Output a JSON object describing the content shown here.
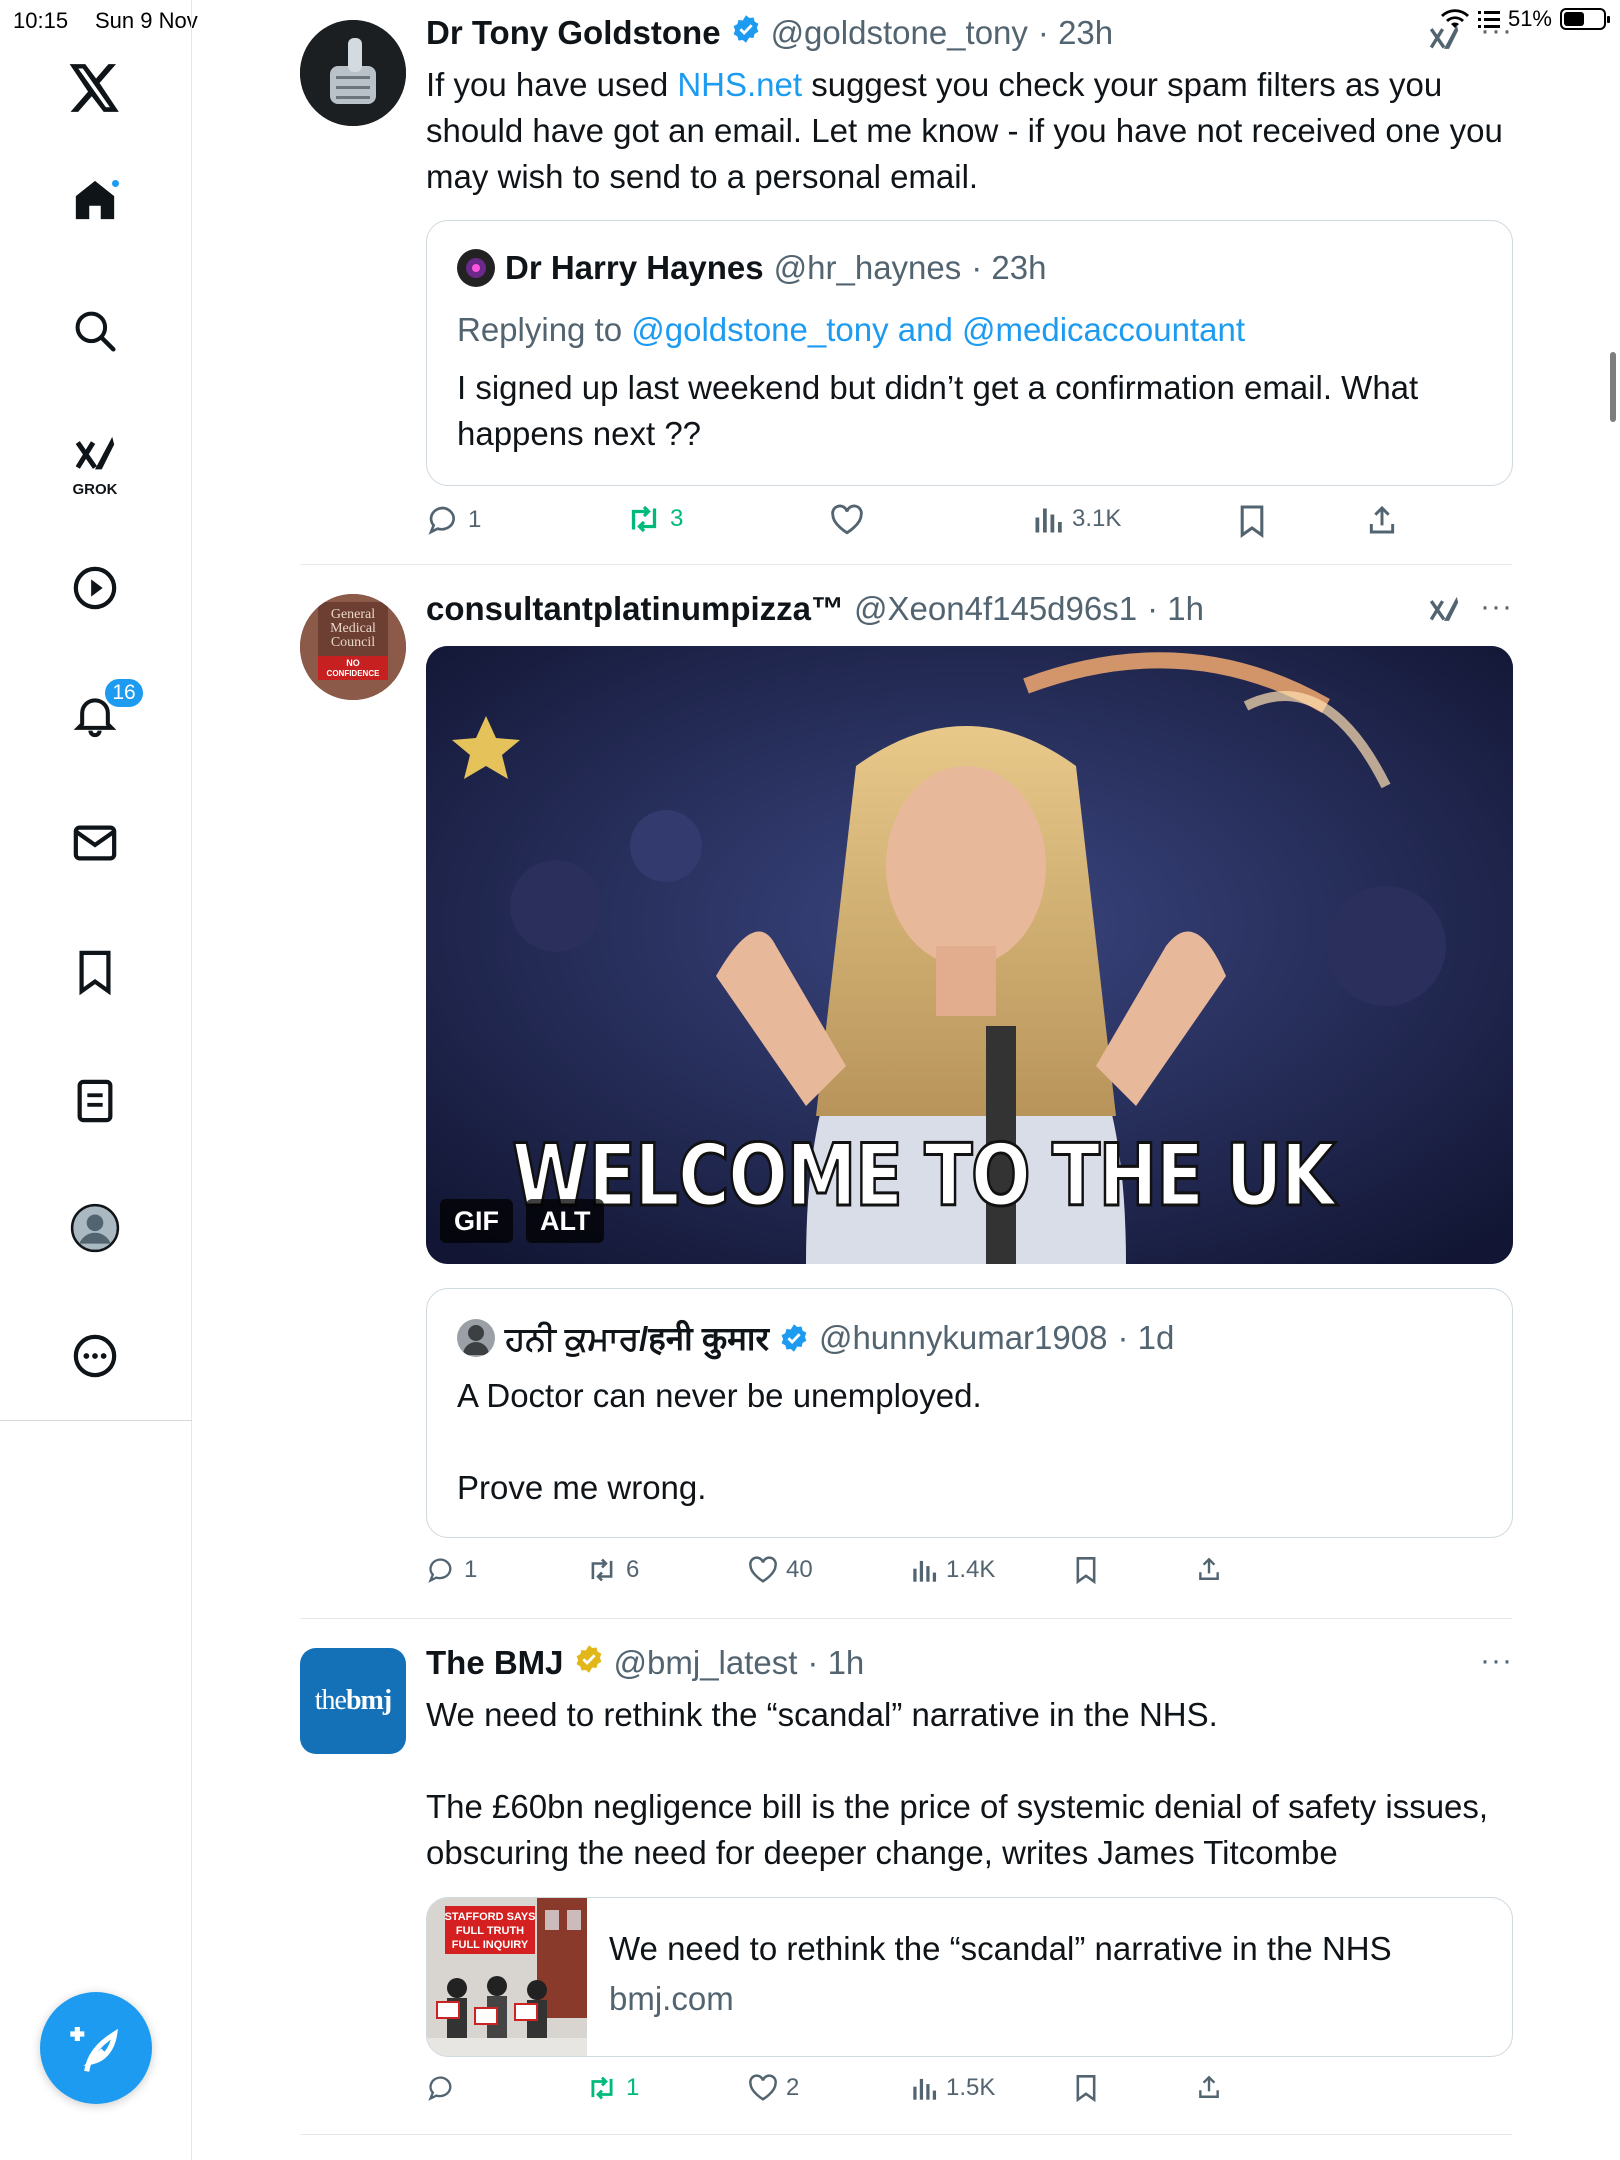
{
  "status_bar": {
    "time": "10:15",
    "date": "Sun 9 Nov",
    "battery": "51%"
  },
  "nav": {
    "notifications_badge": "16",
    "grok_label": "GROK"
  },
  "posts": [
    {
      "name": "Dr Tony Goldstone",
      "handle": "@goldstone_tony",
      "time": "· 23h",
      "text_before": "If you have used ",
      "link": "NHS.net",
      "text_after": " suggest you check your spam filters as you should have got an email. Let me know - if you have not received one you may wish to send to a personal email.",
      "quote": {
        "name": "Dr Harry Haynes",
        "handle": "@hr_haynes",
        "time": "· 23h",
        "replying_prefix": "Replying to ",
        "replying_to": "@goldstone_tony and @medicaccountant",
        "text": "I signed up last weekend but didn’t get a confirmation email.   What happens next ??"
      },
      "stats": {
        "replies": "1",
        "reposts": "3",
        "likes": "",
        "views": "3.1K"
      }
    },
    {
      "name": "consultantplatinumpizza™",
      "handle": "@Xeon4f145d96s1",
      "time": "· 1h",
      "avatar_text": [
        "General",
        "Medical",
        "Council",
        "NO",
        "CONFIDENCE"
      ],
      "media": {
        "caption": "WELCOME TO THE UK",
        "gif_label": "GIF",
        "alt_label": "ALT"
      },
      "quote": {
        "name": "ਹਨੀ ਕੁਮਾਰ/हनी कुमार",
        "handle": "@hunnykumar1908",
        "time": "· 1d",
        "text1": "A Doctor can never be unemployed.",
        "text2": "Prove me wrong."
      },
      "stats": {
        "replies": "1",
        "reposts": "6",
        "likes": "40",
        "views": "1.4K"
      }
    },
    {
      "name": "The BMJ",
      "handle": "@bmj_latest",
      "time": "· 1h",
      "avatar_text_a": "the",
      "avatar_text_b": "bmj",
      "text1": "We need to rethink the “scandal” narrative in the NHS.",
      "text2": "The £60bn negligence bill is the price of systemic denial of safety issues, obscuring the need for deeper change, writes James Titcombe",
      "card": {
        "title": "We need to rethink the “scandal” narrative in the NHS",
        "domain": "bmj.com",
        "banner": [
          "STAFFORD SAYS",
          "FULL TRUTH",
          "FULL INQUIRY"
        ]
      },
      "stats": {
        "replies": "",
        "reposts": "1",
        "likes": "2",
        "views": "1.5K"
      }
    }
  ],
  "colors": {
    "accent": "#1d9bf0",
    "repost_green": "#00ba7c",
    "gold_badge": "#e2b719",
    "muted": "#536471"
  }
}
